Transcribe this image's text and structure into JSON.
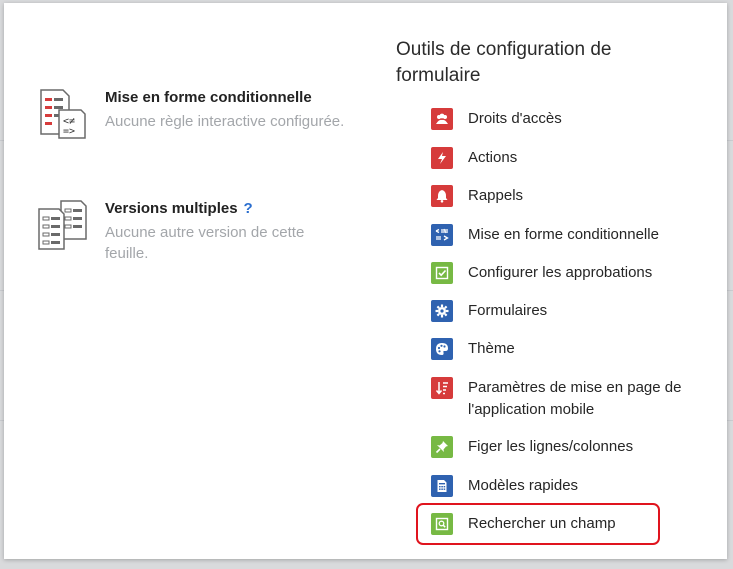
{
  "features": [
    {
      "title": "Mise en forme conditionnelle",
      "help": "",
      "desc": "Aucune règle interactive configurée."
    },
    {
      "title": "Versions multiples",
      "help": "?",
      "desc": "Aucune autre version de cette feuille."
    }
  ],
  "tools": {
    "title": "Outils de configuration de formulaire",
    "items": [
      {
        "label": "Droits d'accès",
        "icon": "users-icon",
        "color": "#d63b3b"
      },
      {
        "label": "Actions",
        "icon": "lightning-icon",
        "color": "#d63b3b"
      },
      {
        "label": "Rappels",
        "icon": "bell-icon",
        "color": "#d63b3b"
      },
      {
        "label": "Mise en forme conditionnelle",
        "icon": "conditional-format-icon",
        "color": "#2f62b0"
      },
      {
        "label": "Configurer les approbations",
        "icon": "checkbox-icon",
        "color": "#77b944"
      },
      {
        "label": "Formulaires",
        "icon": "gear-icon",
        "color": "#2f62b0"
      },
      {
        "label": "Thème",
        "icon": "palette-icon",
        "color": "#2f62b0"
      },
      {
        "label": "Paramètres de mise en page de l'application mobile",
        "icon": "sort-icon",
        "color": "#d63b3b"
      },
      {
        "label": "Figer les lignes/colonnes",
        "icon": "pin-icon",
        "color": "#77b944"
      },
      {
        "label": "Modèles rapides",
        "icon": "template-icon",
        "color": "#2f62b0"
      },
      {
        "label": "Rechercher un champ",
        "icon": "search-field-icon",
        "color": "#77b944"
      }
    ]
  }
}
